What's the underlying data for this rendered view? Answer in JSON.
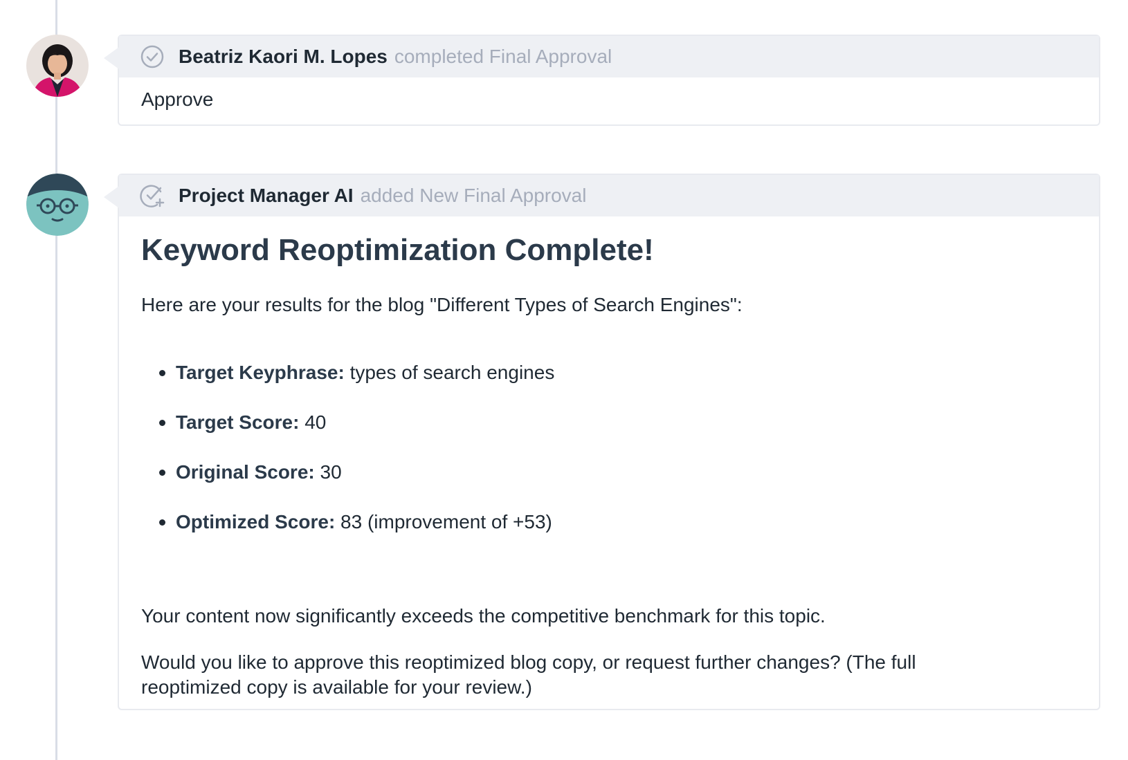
{
  "entries": [
    {
      "author": "Beatriz Kaori M. Lopes",
      "action": "completed Final Approval",
      "status_icon": "check-circle-icon",
      "body": "Approve"
    },
    {
      "author": "Project Manager AI",
      "action": "added New Final Approval",
      "status_icon": "check-circle-plus-icon",
      "headline": "Keyword Reoptimization Complete!",
      "intro": "Here are your results for the blog \"Different Types of Search Engines\":",
      "results": [
        {
          "label": "Target Keyphrase:",
          "value": "types of search engines"
        },
        {
          "label": "Target Score:",
          "value": "40"
        },
        {
          "label": "Original Score:",
          "value": "30"
        },
        {
          "label": "Optimized Score:",
          "value": "83 (improvement of +53)"
        }
      ],
      "summary": "Your content now significantly exceeds the competitive benchmark for this topic.",
      "question": "Would you like to approve this reoptimized blog copy, or request further changes? (The full reoptimized copy is available for your review.)"
    }
  ],
  "colors": {
    "timeline": "#d9dde6",
    "header_bg": "#eef0f4",
    "muted_text": "#a6adbb",
    "bot_face": "#7cc3c0",
    "bot_hair": "#2f4858",
    "user_jacket": "#d4146a"
  }
}
